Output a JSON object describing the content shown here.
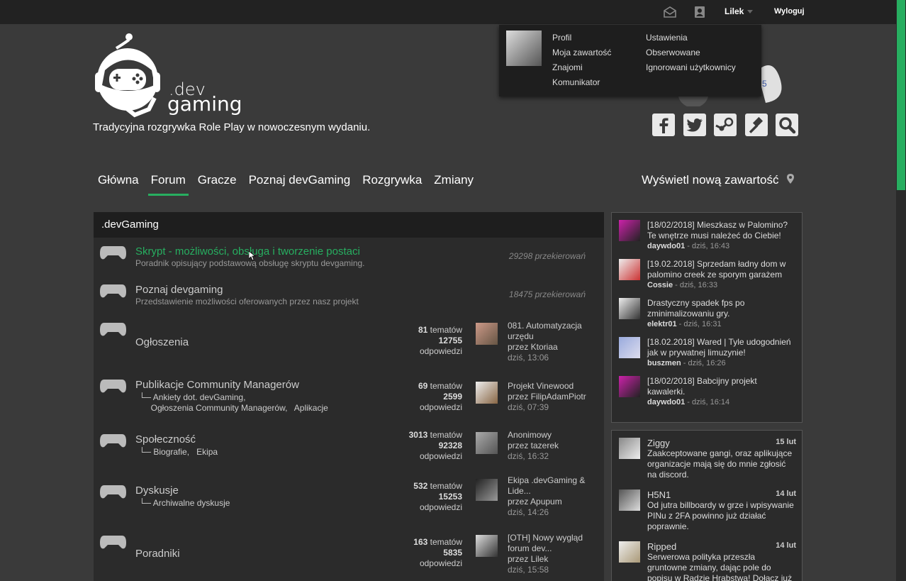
{
  "topbar": {
    "username": "Lilek",
    "logout": "Wyloguj"
  },
  "dropdown": {
    "profile": "Profil",
    "my_content": "Moja zawartość",
    "friends": "Znajomi",
    "messenger": "Komunikator",
    "settings": "Ustawienia",
    "followed": "Obserwowane",
    "ignored": "Ignorowani użytkownicy"
  },
  "logo": {
    "line1": ".dev",
    "line2": "gaming"
  },
  "tagline": "Tradycyjna rozgrywka Role Play w nowoczesnym wydaniu.",
  "nav": {
    "items": [
      "Główna",
      "Forum",
      "Gracze",
      "Poznaj devGaming",
      "Rozgrywka",
      "Zmiany"
    ],
    "active_index": 1,
    "new_content": "Wyświetl nową zawartość"
  },
  "social_icons": [
    "facebook-icon",
    "twitter-icon",
    "steam-icon",
    "gavel-icon",
    "search-icon"
  ],
  "forum": {
    "header": ".devGaming",
    "rows": [
      {
        "title": "Skrypt - możliwości, obsługa i tworzenie postaci",
        "desc": "Poradnik opisujący podstawową obsługę skryptu devgaming.",
        "redirects": "29298 przekierowań"
      },
      {
        "title": "Poznaj devgaming",
        "desc": "Przedstawienie możliwości oferowanych przez nasz projekt",
        "redirects": "18475 przekierowań"
      },
      {
        "title": "Ogłoszenia",
        "topics": "81",
        "topics_label": "tematów",
        "replies": "12755",
        "replies_label": "odpowiedzi",
        "last_title": "081. Automatyzacja urzędu",
        "last_by": "przez Ktoriaa",
        "last_time": "dziś, 13:06"
      },
      {
        "title": "Publikacje Community Managerów",
        "sub1": "Ankiety dot. devGaming,",
        "sub2": "Ogłoszenia Community Managerów,",
        "sub3": "Aplikacje",
        "topics": "69",
        "topics_label": "tematów",
        "replies": "2599",
        "replies_label": "odpowiedzi",
        "last_title": "Projekt Vinewood",
        "last_by": "przez FilipAdamPiotr",
        "last_time": "dziś, 07:39"
      },
      {
        "title": "Społeczność",
        "sub1": "Biografie,",
        "sub2": "Ekipa",
        "topics": "3013",
        "topics_label": "tematów",
        "replies": "92328",
        "replies_label": "odpowiedzi",
        "last_title": "Anonimowy",
        "last_by": "przez tazerek",
        "last_time": "dziś, 16:32"
      },
      {
        "title": "Dyskusje",
        "sub1": "Archiwalne dyskusje",
        "topics": "532",
        "topics_label": "tematów",
        "replies": "15253",
        "replies_label": "odpowiedzi",
        "last_title": "Ekipa .devGaming & Lide...",
        "last_by": "przez Apupum",
        "last_time": "dziś, 14:26"
      },
      {
        "title": "Poradniki",
        "topics": "163",
        "topics_label": "tematów",
        "replies": "5835",
        "replies_label": "odpowiedzi",
        "last_title": "[OTH] Nowy wygląd forum dev...",
        "last_by": "przez Lilek",
        "last_time": "dziś, 15:58"
      }
    ]
  },
  "recent_topics": [
    {
      "title": "[18/02/2018] Mieszkasz w Palomino? Te wnętrze musi należeć do Ciebie!",
      "author": "daywdo01",
      "time": "dziś, 16:43"
    },
    {
      "title": "[19.02.2018] Sprzedam ładny dom w palomino creek ze sporym garażem",
      "author": "Cossie",
      "time": "dziś, 16:33"
    },
    {
      "title": "Drastyczny spadek fps po zminimalizowaniu gry.",
      "author": "elektr01",
      "time": "dziś, 16:31"
    },
    {
      "title": "[18.02.2018] Wared | Tyle udogodnień jak w prywatnej limuzynie!",
      "author": "buszmen",
      "time": "dziś, 16:26"
    },
    {
      "title": "[18/02/2018] Babcijny projekt kawalerki.",
      "author": "daywdo01",
      "time": "dziś, 16:14"
    }
  ],
  "status_updates": [
    {
      "name": "Ziggy",
      "date": "15 lut",
      "text": "Zaakceptowane gangi, oraz aplikujące organizacje mają się do mnie zgłosić na discord."
    },
    {
      "name": "H5N1",
      "date": "14 lut",
      "text": "Od jutra billboardy w grze i wpisywanie PINu z 2FA powinno już działać poprawnie."
    },
    {
      "name": "Ripped",
      "date": "14 lut",
      "text": "Serwerowa polityka przeszła gruntowne zmiany, dając pole do popisu w Radzie Hrabstwa! Dołącz już"
    }
  ],
  "colors": {
    "accent": "#27ae60",
    "background": "#3a3a3a",
    "panel": "#2b2b2b",
    "topbar": "#222222"
  }
}
